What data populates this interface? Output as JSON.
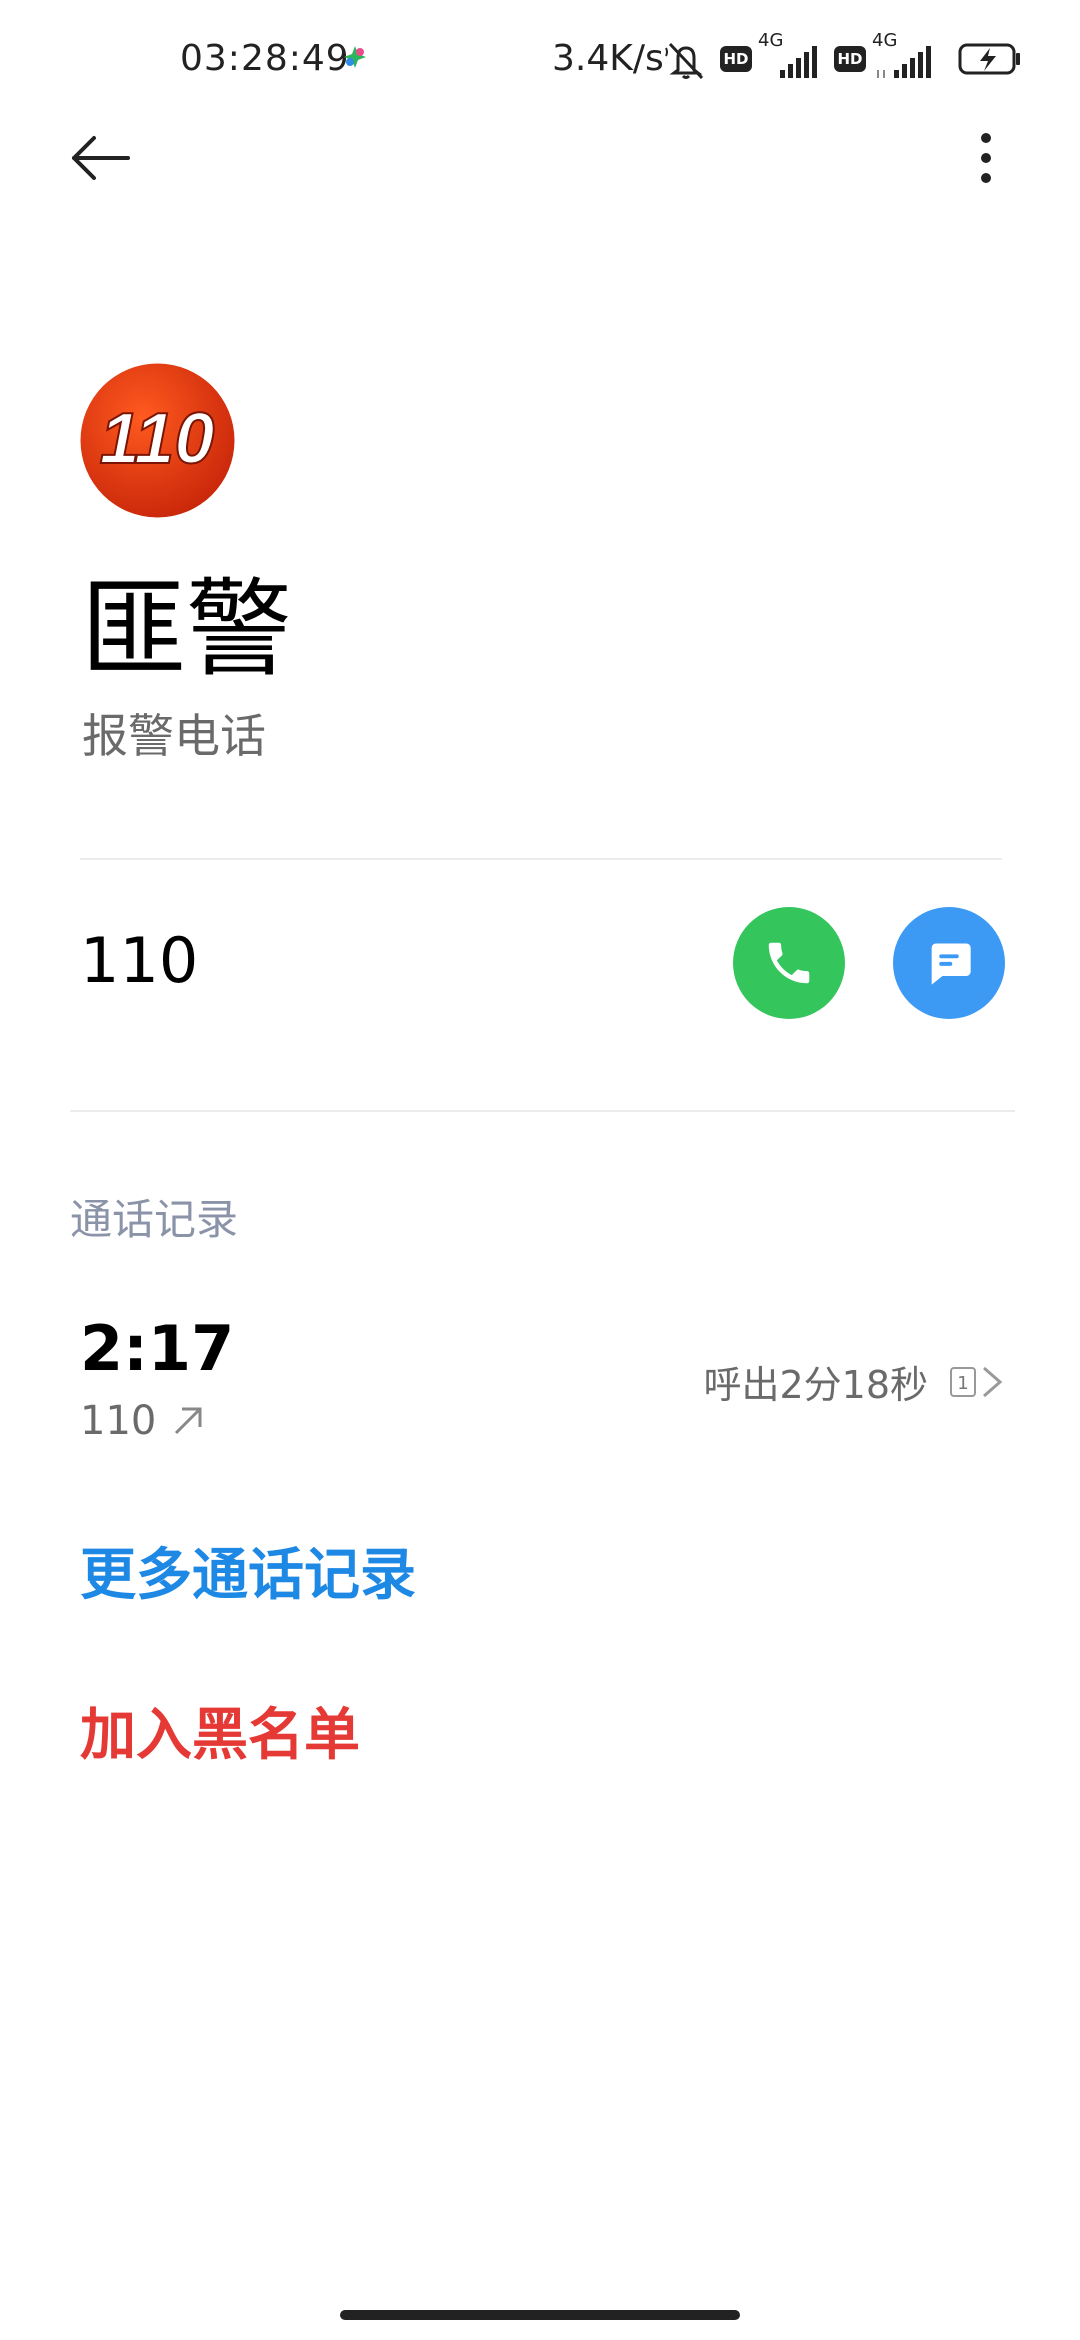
{
  "status_bar": {
    "time": "03:28:49",
    "net_speed": "3.4K/s",
    "sim1": {
      "badge": "HD",
      "network": "4G"
    },
    "sim2": {
      "badge": "HD",
      "network": "4G"
    },
    "icons": [
      "app-notification-icon",
      "mute-icon",
      "battery-charging-icon"
    ]
  },
  "app_bar": {
    "back_icon": "arrow-left-icon",
    "menu_icon": "more-vertical-icon"
  },
  "contact": {
    "avatar_text": "110",
    "avatar_color": "#d8340f",
    "name": "匪警",
    "subtitle": "报警电话"
  },
  "number_row": {
    "number": "110",
    "call_color": "#34c55d",
    "message_color": "#3d9af4"
  },
  "call_log": {
    "section_label": "通话记录",
    "entries": [
      {
        "time": "2:17",
        "number": "110",
        "direction_icon": "outgoing-arrow-icon",
        "description": "呼出2分18秒",
        "sim": "1"
      }
    ],
    "more_label": "更多通话记录",
    "more_color": "#1e88e5"
  },
  "actions": {
    "blacklist_label": "加入黑名单",
    "blacklist_color": "#e53935"
  }
}
